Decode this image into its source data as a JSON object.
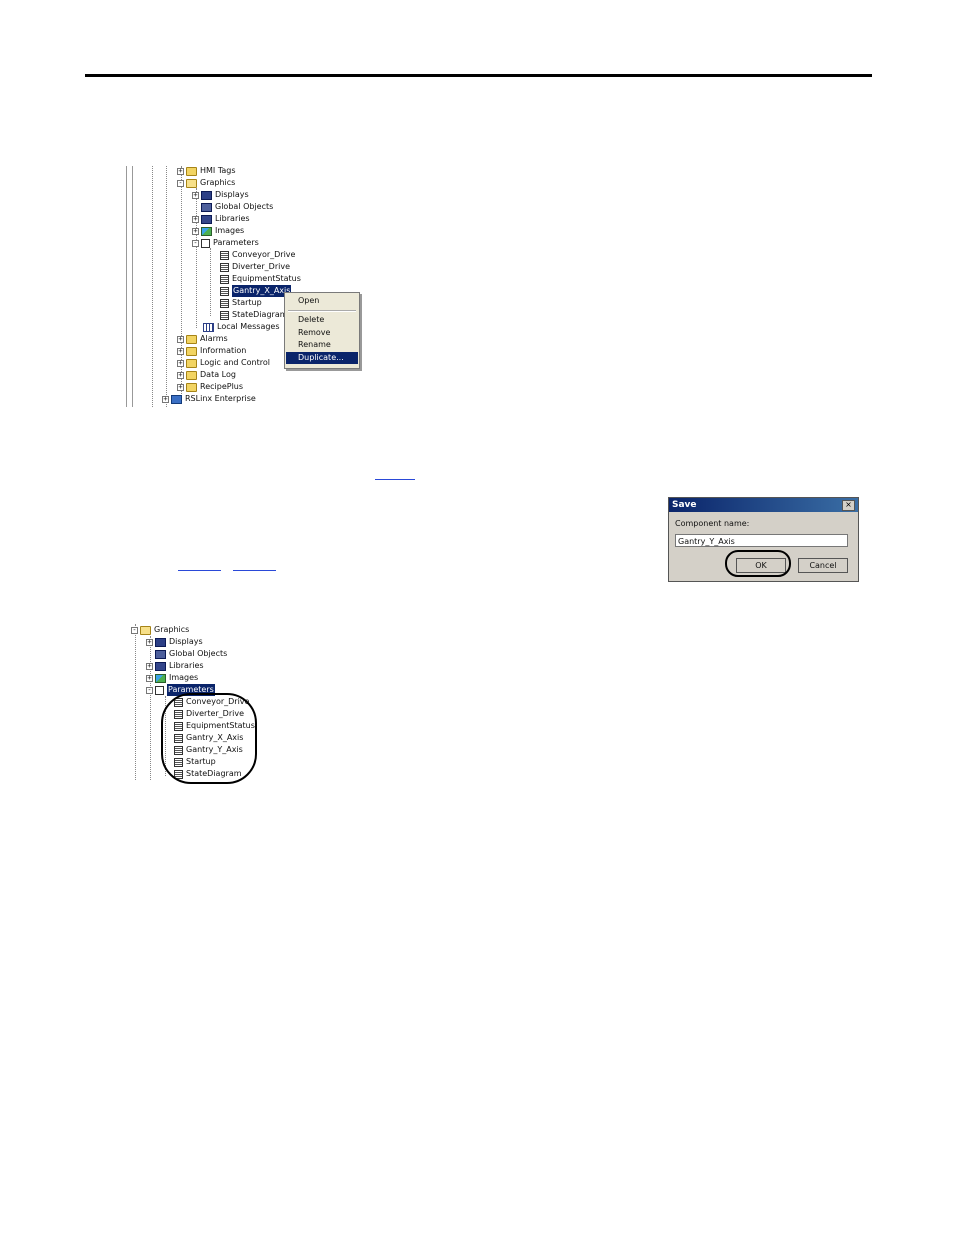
{
  "tree1": {
    "items": [
      {
        "label": "HMI Tags",
        "icon": "folder-icon",
        "exp": "+"
      },
      {
        "label": "Graphics",
        "icon": "folder-open-icon",
        "exp": "-"
      },
      {
        "label": "Displays",
        "icon": "displays-icon",
        "exp": "+"
      },
      {
        "label": "Global Objects",
        "icon": "global-objects-icon",
        "exp": ""
      },
      {
        "label": "Libraries",
        "icon": "libraries-icon",
        "exp": "+"
      },
      {
        "label": "Images",
        "icon": "images-icon",
        "exp": "+"
      },
      {
        "label": "Parameters",
        "icon": "parameters-icon",
        "exp": "-"
      },
      {
        "label": "Conveyor_Drive",
        "icon": "document-icon",
        "exp": ""
      },
      {
        "label": "Diverter_Drive",
        "icon": "document-icon",
        "exp": ""
      },
      {
        "label": "EquipmentStatus",
        "icon": "document-icon",
        "exp": ""
      },
      {
        "label": "Gantry_X_Axis",
        "icon": "document-icon",
        "exp": ""
      },
      {
        "label": "Startup",
        "icon": "document-icon",
        "exp": ""
      },
      {
        "label": "StateDiagram",
        "icon": "document-icon",
        "exp": ""
      },
      {
        "label": "Local Messages",
        "icon": "local-messages-icon",
        "exp": ""
      },
      {
        "label": "Alarms",
        "icon": "folder-icon",
        "exp": "+"
      },
      {
        "label": "Information",
        "icon": "folder-icon",
        "exp": "+"
      },
      {
        "label": "Logic and Control",
        "icon": "folder-icon",
        "exp": "+"
      },
      {
        "label": "Data Log",
        "icon": "folder-icon",
        "exp": "+"
      },
      {
        "label": "RecipePlus",
        "icon": "folder-icon",
        "exp": "+"
      },
      {
        "label": "RSLinx Enterprise",
        "icon": "rslinx-icon",
        "exp": "+"
      }
    ]
  },
  "context_menu": {
    "items": [
      "Open",
      "Delete",
      "Remove",
      "Rename",
      "Duplicate..."
    ]
  },
  "save_dialog": {
    "title": "Save",
    "close_glyph": "×",
    "field_label": "Component name:",
    "field_value": "Gantry_Y_Axis",
    "ok_label": "OK",
    "cancel_label": "Cancel"
  },
  "tree2": {
    "items": [
      {
        "label": "Graphics",
        "icon": "folder-open-icon",
        "exp": "-"
      },
      {
        "label": "Displays",
        "icon": "displays-icon",
        "exp": "+"
      },
      {
        "label": "Global Objects",
        "icon": "global-objects-icon",
        "exp": ""
      },
      {
        "label": "Libraries",
        "icon": "libraries-icon",
        "exp": "+"
      },
      {
        "label": "Images",
        "icon": "images-icon",
        "exp": "+"
      },
      {
        "label": "Parameters",
        "icon": "parameters-icon",
        "exp": "-"
      },
      {
        "label": "Conveyor_Drive",
        "icon": "document-icon",
        "exp": ""
      },
      {
        "label": "Diverter_Drive",
        "icon": "document-icon",
        "exp": ""
      },
      {
        "label": "EquipmentStatus",
        "icon": "document-icon",
        "exp": ""
      },
      {
        "label": "Gantry_X_Axis",
        "icon": "document-icon",
        "exp": ""
      },
      {
        "label": "Gantry_Y_Axis",
        "icon": "document-icon",
        "exp": ""
      },
      {
        "label": "Startup",
        "icon": "document-icon",
        "exp": ""
      },
      {
        "label": "StateDiagram",
        "icon": "document-icon",
        "exp": ""
      }
    ]
  },
  "colors": {
    "selection": "#0a246a",
    "link": "#2a49d8",
    "dialog_face": "#d4d0c8"
  }
}
